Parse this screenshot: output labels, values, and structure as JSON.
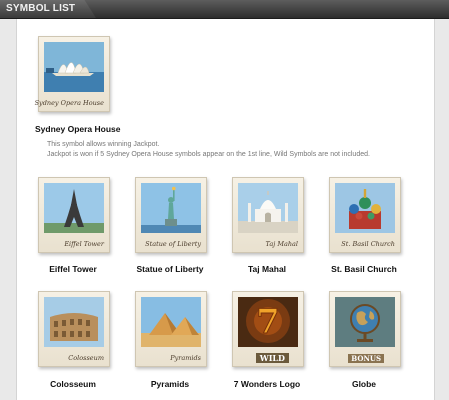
{
  "header": {
    "title": "SYMBOL LIST"
  },
  "jackpot": {
    "name": "Sydney Opera House",
    "caption": "Sydney Opera House",
    "desc_line1": "This symbol allows winning Jackpot.",
    "desc_line2": "Jackpot is won if 5 Sydney Opera House symbols appear on the 1st line, Wild Symbols are not included."
  },
  "symbols": [
    {
      "name": "Eiffel Tower",
      "caption": "Eiffel Tower"
    },
    {
      "name": "Statue of Liberty",
      "caption": "Statue of Liberty"
    },
    {
      "name": "Taj Mahal",
      "caption": "Taj Mahal"
    },
    {
      "name": "St. Basil Church",
      "caption": "St. Basil Church"
    },
    {
      "name": "Colosseum",
      "caption": "Colosseum"
    },
    {
      "name": "Pyramids",
      "caption": "Pyramids"
    },
    {
      "name": "7 Wonders Logo",
      "caption": "WILD",
      "art_label": "7"
    },
    {
      "name": "Globe",
      "caption": "BONUS"
    }
  ],
  "colors": {
    "header_bg": "#3a3a3a",
    "card_bg": "#f1ebdc",
    "sky": "#7fb6d8",
    "wild_orange": "#e07a1a"
  }
}
